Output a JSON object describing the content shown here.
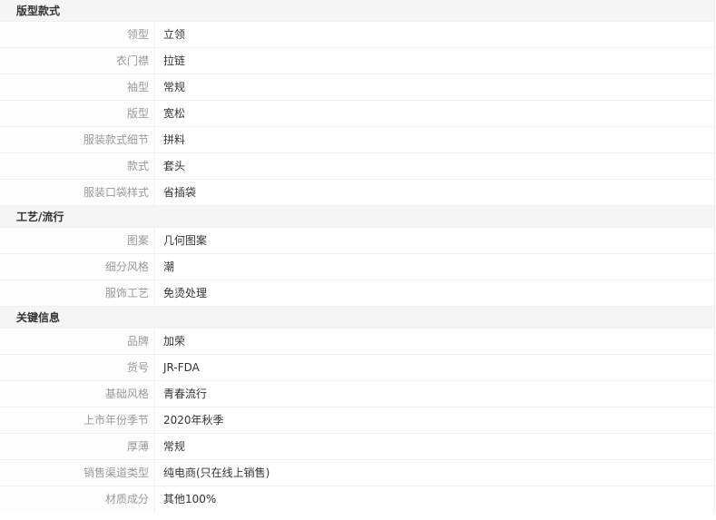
{
  "groups": [
    {
      "title": "版型款式",
      "rows": [
        {
          "label": "领型",
          "value": "立领"
        },
        {
          "label": "衣门襟",
          "value": "拉链"
        },
        {
          "label": "袖型",
          "value": "常规"
        },
        {
          "label": "版型",
          "value": "宽松"
        },
        {
          "label": "服装款式细节",
          "value": "拼料"
        },
        {
          "label": "款式",
          "value": "套头"
        },
        {
          "label": "服装口袋样式",
          "value": "省插袋"
        }
      ]
    },
    {
      "title": "工艺/流行",
      "rows": [
        {
          "label": "图案",
          "value": "几何图案"
        },
        {
          "label": "细分风格",
          "value": "潮"
        },
        {
          "label": "服饰工艺",
          "value": "免烫处理"
        }
      ]
    },
    {
      "title": "关键信息",
      "rows": [
        {
          "label": "品牌",
          "value": "加荣"
        },
        {
          "label": "货号",
          "value": "JR-FDA"
        },
        {
          "label": "基础风格",
          "value": "青春流行"
        },
        {
          "label": "上市年份季节",
          "value": "2020年秋季"
        },
        {
          "label": "厚薄",
          "value": "常规"
        },
        {
          "label": "销售渠道类型",
          "value": "纯电商(只在线上销售)"
        },
        {
          "label": "材质成分",
          "value": "其他100%"
        }
      ]
    }
  ]
}
